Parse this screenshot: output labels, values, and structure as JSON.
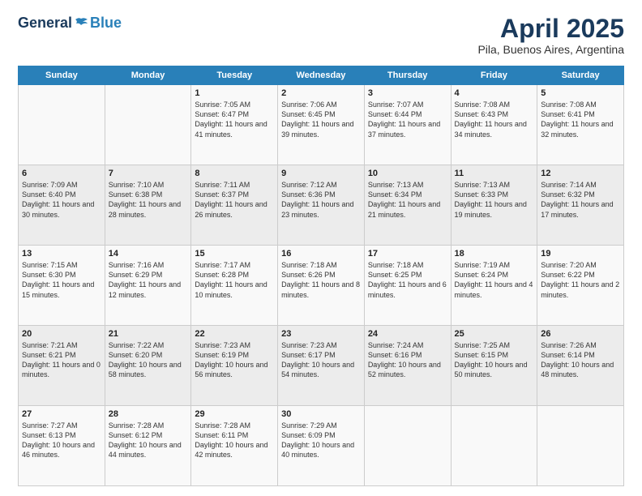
{
  "logo": {
    "text_general": "General",
    "text_blue": "Blue"
  },
  "header": {
    "title": "April 2025",
    "subtitle": "Pila, Buenos Aires, Argentina"
  },
  "calendar": {
    "days_of_week": [
      "Sunday",
      "Monday",
      "Tuesday",
      "Wednesday",
      "Thursday",
      "Friday",
      "Saturday"
    ],
    "weeks": [
      [
        {
          "day": "",
          "content": ""
        },
        {
          "day": "",
          "content": ""
        },
        {
          "day": "1",
          "content": "Sunrise: 7:05 AM\nSunset: 6:47 PM\nDaylight: 11 hours and 41 minutes."
        },
        {
          "day": "2",
          "content": "Sunrise: 7:06 AM\nSunset: 6:45 PM\nDaylight: 11 hours and 39 minutes."
        },
        {
          "day": "3",
          "content": "Sunrise: 7:07 AM\nSunset: 6:44 PM\nDaylight: 11 hours and 37 minutes."
        },
        {
          "day": "4",
          "content": "Sunrise: 7:08 AM\nSunset: 6:43 PM\nDaylight: 11 hours and 34 minutes."
        },
        {
          "day": "5",
          "content": "Sunrise: 7:08 AM\nSunset: 6:41 PM\nDaylight: 11 hours and 32 minutes."
        }
      ],
      [
        {
          "day": "6",
          "content": "Sunrise: 7:09 AM\nSunset: 6:40 PM\nDaylight: 11 hours and 30 minutes."
        },
        {
          "day": "7",
          "content": "Sunrise: 7:10 AM\nSunset: 6:38 PM\nDaylight: 11 hours and 28 minutes."
        },
        {
          "day": "8",
          "content": "Sunrise: 7:11 AM\nSunset: 6:37 PM\nDaylight: 11 hours and 26 minutes."
        },
        {
          "day": "9",
          "content": "Sunrise: 7:12 AM\nSunset: 6:36 PM\nDaylight: 11 hours and 23 minutes."
        },
        {
          "day": "10",
          "content": "Sunrise: 7:13 AM\nSunset: 6:34 PM\nDaylight: 11 hours and 21 minutes."
        },
        {
          "day": "11",
          "content": "Sunrise: 7:13 AM\nSunset: 6:33 PM\nDaylight: 11 hours and 19 minutes."
        },
        {
          "day": "12",
          "content": "Sunrise: 7:14 AM\nSunset: 6:32 PM\nDaylight: 11 hours and 17 minutes."
        }
      ],
      [
        {
          "day": "13",
          "content": "Sunrise: 7:15 AM\nSunset: 6:30 PM\nDaylight: 11 hours and 15 minutes."
        },
        {
          "day": "14",
          "content": "Sunrise: 7:16 AM\nSunset: 6:29 PM\nDaylight: 11 hours and 12 minutes."
        },
        {
          "day": "15",
          "content": "Sunrise: 7:17 AM\nSunset: 6:28 PM\nDaylight: 11 hours and 10 minutes."
        },
        {
          "day": "16",
          "content": "Sunrise: 7:18 AM\nSunset: 6:26 PM\nDaylight: 11 hours and 8 minutes."
        },
        {
          "day": "17",
          "content": "Sunrise: 7:18 AM\nSunset: 6:25 PM\nDaylight: 11 hours and 6 minutes."
        },
        {
          "day": "18",
          "content": "Sunrise: 7:19 AM\nSunset: 6:24 PM\nDaylight: 11 hours and 4 minutes."
        },
        {
          "day": "19",
          "content": "Sunrise: 7:20 AM\nSunset: 6:22 PM\nDaylight: 11 hours and 2 minutes."
        }
      ],
      [
        {
          "day": "20",
          "content": "Sunrise: 7:21 AM\nSunset: 6:21 PM\nDaylight: 11 hours and 0 minutes."
        },
        {
          "day": "21",
          "content": "Sunrise: 7:22 AM\nSunset: 6:20 PM\nDaylight: 10 hours and 58 minutes."
        },
        {
          "day": "22",
          "content": "Sunrise: 7:23 AM\nSunset: 6:19 PM\nDaylight: 10 hours and 56 minutes."
        },
        {
          "day": "23",
          "content": "Sunrise: 7:23 AM\nSunset: 6:17 PM\nDaylight: 10 hours and 54 minutes."
        },
        {
          "day": "24",
          "content": "Sunrise: 7:24 AM\nSunset: 6:16 PM\nDaylight: 10 hours and 52 minutes."
        },
        {
          "day": "25",
          "content": "Sunrise: 7:25 AM\nSunset: 6:15 PM\nDaylight: 10 hours and 50 minutes."
        },
        {
          "day": "26",
          "content": "Sunrise: 7:26 AM\nSunset: 6:14 PM\nDaylight: 10 hours and 48 minutes."
        }
      ],
      [
        {
          "day": "27",
          "content": "Sunrise: 7:27 AM\nSunset: 6:13 PM\nDaylight: 10 hours and 46 minutes."
        },
        {
          "day": "28",
          "content": "Sunrise: 7:28 AM\nSunset: 6:12 PM\nDaylight: 10 hours and 44 minutes."
        },
        {
          "day": "29",
          "content": "Sunrise: 7:28 AM\nSunset: 6:11 PM\nDaylight: 10 hours and 42 minutes."
        },
        {
          "day": "30",
          "content": "Sunrise: 7:29 AM\nSunset: 6:09 PM\nDaylight: 10 hours and 40 minutes."
        },
        {
          "day": "",
          "content": ""
        },
        {
          "day": "",
          "content": ""
        },
        {
          "day": "",
          "content": ""
        }
      ]
    ]
  }
}
